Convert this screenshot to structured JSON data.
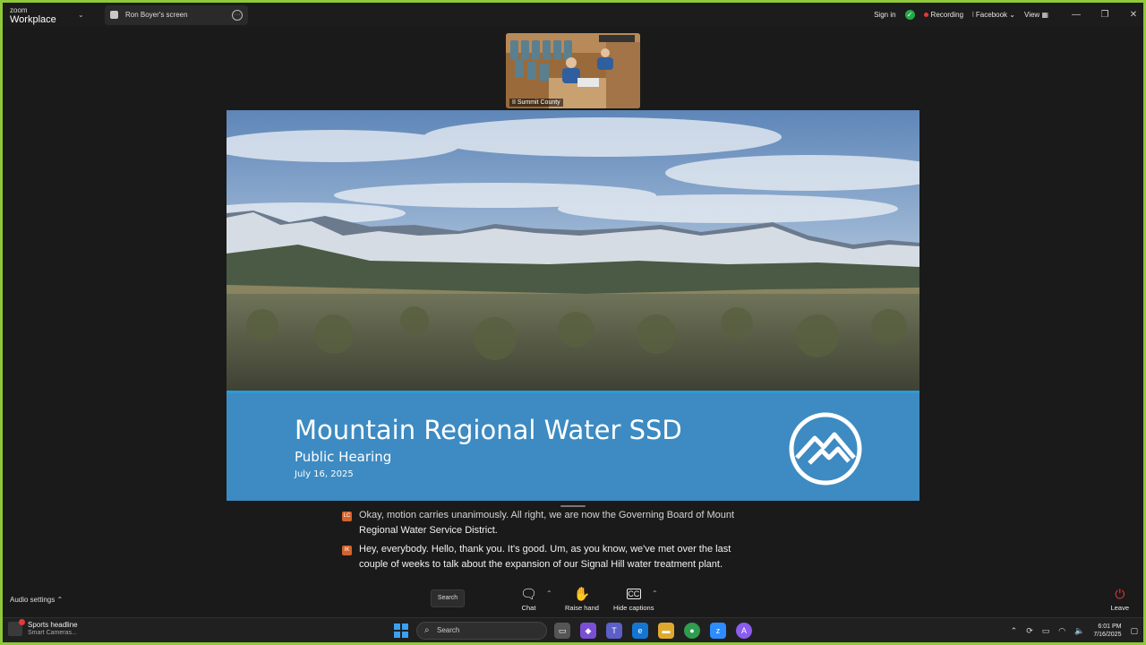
{
  "titlebar": {
    "brand_small": "zoom",
    "brand_big": "Workplace",
    "tab_label": "Ron Boyer's screen",
    "sign_in": "Sign in",
    "recording": "Recording",
    "facebook": "Facebook",
    "view": "View"
  },
  "thumbnail": {
    "label": "II Summit County"
  },
  "slide": {
    "title": "Mountain Regional Water SSD",
    "subtitle": "Public Hearing",
    "date": "July 16, 2025"
  },
  "captions": [
    {
      "initials": "LC",
      "line1": "Okay, motion carries unanimously. All right, we are now the Governing Board of Mount",
      "line2": "Regional Water Service District."
    },
    {
      "initials": "IK",
      "line1": "Hey, everybody. Hello, thank you. It's good. Um, as you know, we've met over the last",
      "line2": "couple of weeks to talk about the expansion of our Signal Hill water treatment plant."
    }
  ],
  "toolbar": {
    "audio_settings": "Audio settings",
    "search": "Search",
    "chat": "Chat",
    "raise_hand": "Raise hand",
    "hide_captions": "Hide captions",
    "leave": "Leave"
  },
  "taskbar": {
    "news_title": "Sports headline",
    "news_sub": "Smart Cameras...",
    "search_placeholder": "Search",
    "time": "6:01 PM",
    "date": "7/16/2025"
  },
  "colors": {
    "share_border": "#8fc93a",
    "slide_band": "#3d8bc2",
    "record": "#e53935"
  }
}
